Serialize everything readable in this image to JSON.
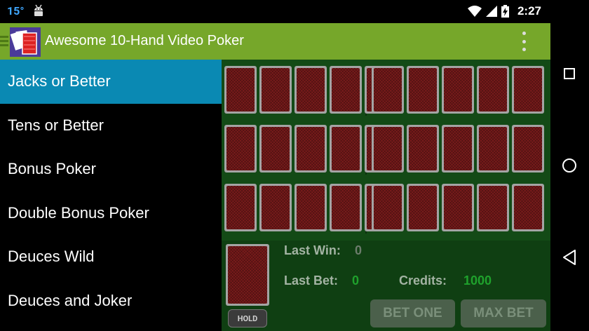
{
  "status_bar": {
    "temperature": "15°",
    "time": "2:27",
    "icons": [
      "android-icon",
      "wifi-icon",
      "signal-icon",
      "battery-charging-icon"
    ]
  },
  "app_bar": {
    "title": "Awesome 10-Hand Video Poker",
    "icons": [
      "drawer-menu-icon",
      "app-logo-icon",
      "overflow-menu-icon"
    ]
  },
  "drawer": {
    "selected_index": 0,
    "items": [
      {
        "label": "Jacks or Better"
      },
      {
        "label": "Tens or Better"
      },
      {
        "label": "Bonus Poker"
      },
      {
        "label": "Double Bonus Poker"
      },
      {
        "label": "Deuces Wild"
      },
      {
        "label": "Deuces and Joker"
      }
    ]
  },
  "game": {
    "hands_visible": 6,
    "cards_per_hand": 5,
    "hold_label": "HOLD",
    "last_win_label": "Last Win:",
    "last_win_value": "0",
    "last_bet_label": "Last Bet:",
    "last_bet_value": "0",
    "credits_label": "Credits:",
    "credits_value": "1000",
    "bet_one_label": "BET ONE",
    "max_bet_label": "MAX BET"
  },
  "colors": {
    "app_bar": "#76a72a",
    "drawer_selected": "#0a89b3",
    "table_felt": "#134a16",
    "card_back": "#7a1b1b",
    "credits_green": "#1fa12c"
  },
  "nav_bar": {
    "icons": [
      "recent-apps-icon",
      "home-icon",
      "back-icon"
    ]
  }
}
